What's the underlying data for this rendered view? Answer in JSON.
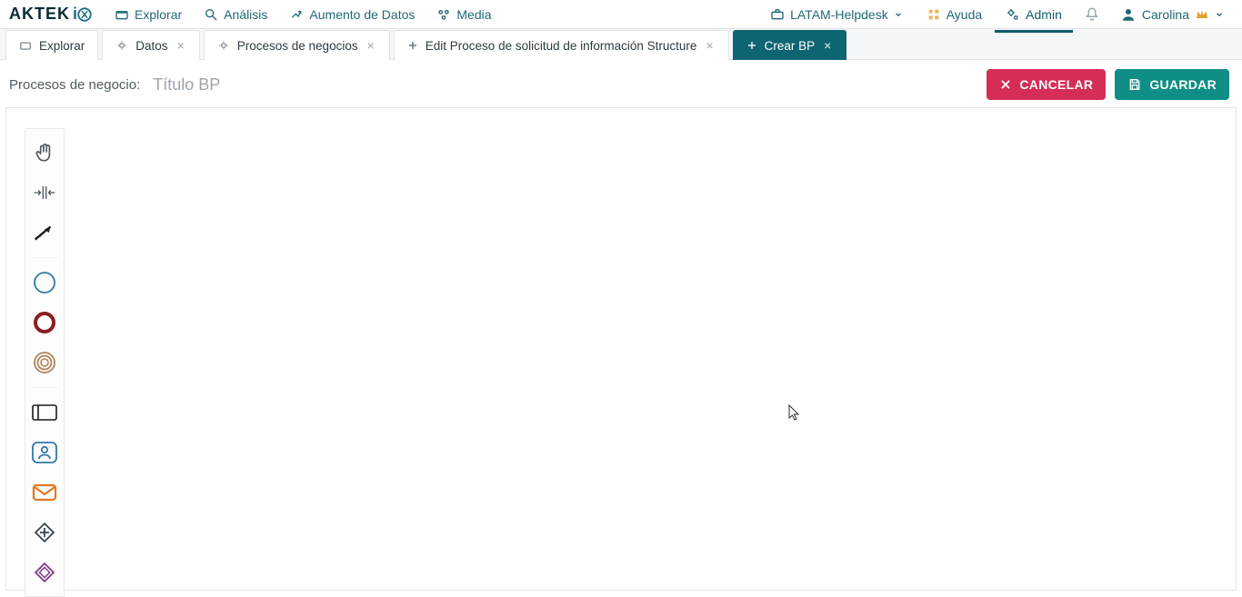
{
  "brand": "AKTEK iO",
  "main_nav": {
    "explorar": "Explorar",
    "analisis": "Análisis",
    "aumento": "Aumento de Datos",
    "media": "Media"
  },
  "right_nav": {
    "workspace": "LATAM-Helpdesk",
    "ayuda": "Ayuda",
    "admin": "Admin",
    "user": "Carolina"
  },
  "tabs": {
    "explorar": "Explorar",
    "datos": "Datos",
    "procesos": "Procesos de negocios",
    "edit_bp": "Edit Proceso de solicitud de información Structure",
    "crear_bp": "Crear BP"
  },
  "title_bar": {
    "crumb": "Procesos de negocio:",
    "placeholder": "Título BP",
    "cancel": "CANCELAR",
    "save": "GUARDAR"
  },
  "tools": {
    "pan": "pan-hand",
    "fit": "fit-horizontal",
    "connect": "connector-arrow",
    "start_event": "start-event",
    "end_event": "end-event",
    "intermediate_event": "intermediate-event",
    "task": "task-rectangle",
    "user_task": "user-task",
    "message_task": "message-task",
    "gateway": "gateway-diamond",
    "gateway_xor": "gateway-xor"
  },
  "colors": {
    "teal": "#0f6472",
    "green": "#0f8e86",
    "pink": "#d42e56",
    "plum": "#7a3b8a",
    "task_blue": "#2f79a8",
    "mail_orange": "#e57822",
    "dark_brown": "#8a1f1f",
    "sand": "#b0835a"
  }
}
